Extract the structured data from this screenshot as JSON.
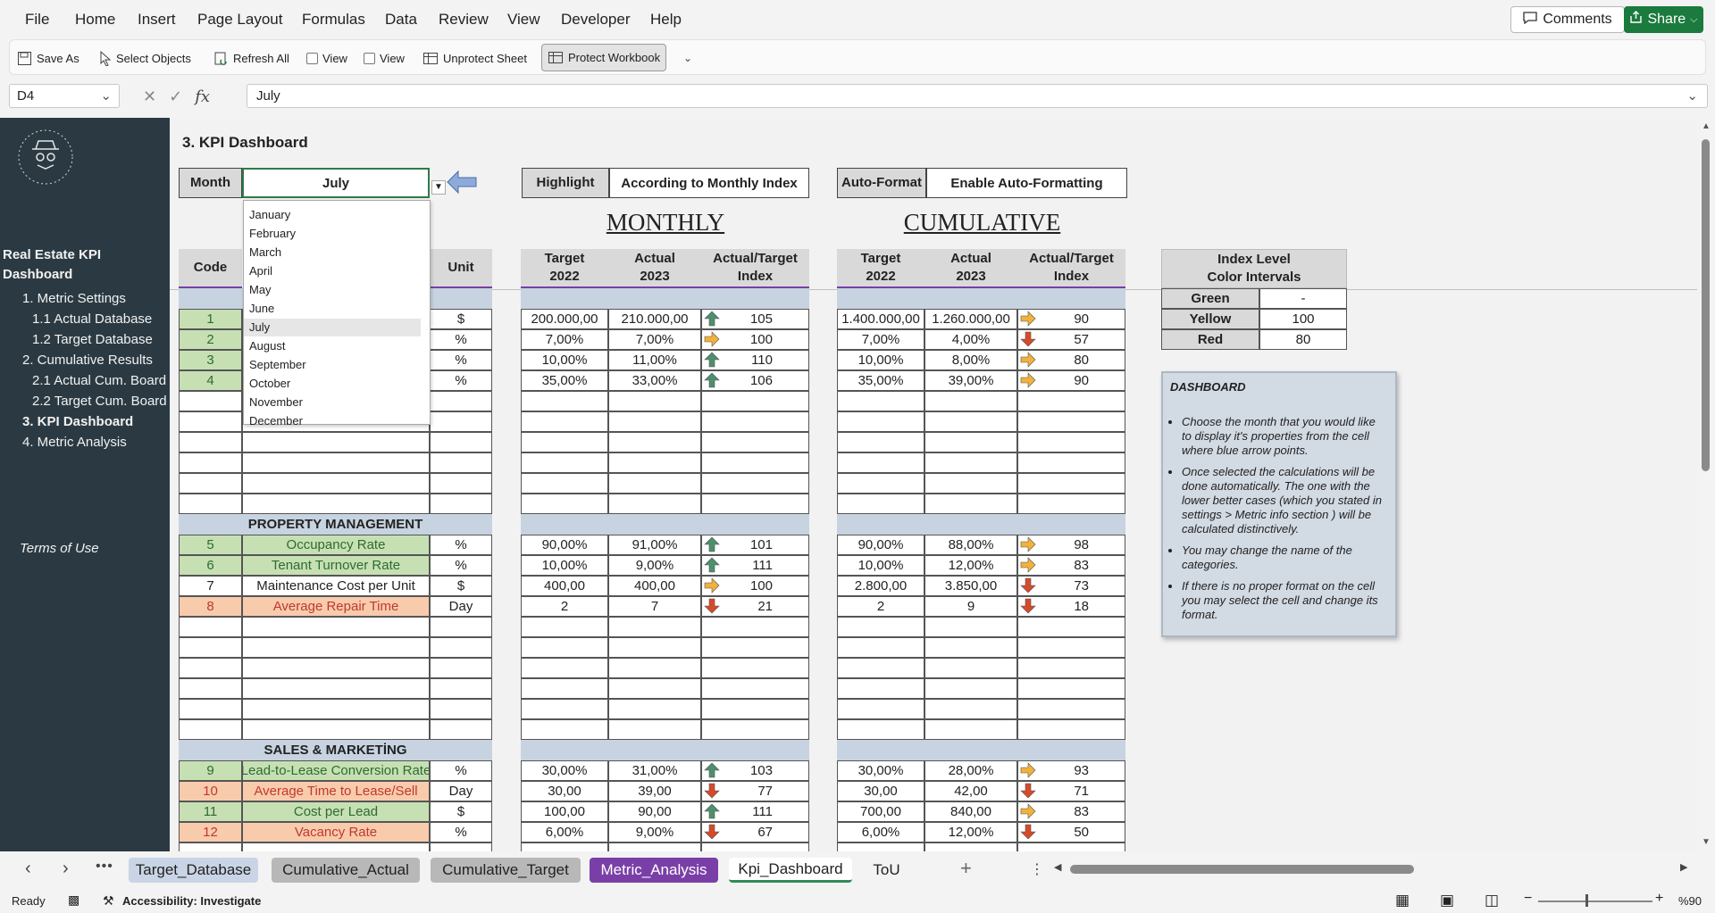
{
  "menu": {
    "file": "File",
    "home": "Home",
    "insert": "Insert",
    "page_layout": "Page Layout",
    "formulas": "Formulas",
    "data": "Data",
    "review": "Review",
    "view": "View",
    "developer": "Developer",
    "help": "Help",
    "comments": "Comments",
    "share": "Share"
  },
  "ribbon": {
    "save_as": "Save As",
    "select_objects": "Select Objects",
    "refresh_all": "Refresh All",
    "view1": "View",
    "view2": "View",
    "unprotect_sheet": "Unprotect Sheet",
    "protect_workbook": "Protect Workbook"
  },
  "formula_bar": {
    "name_box": "D4",
    "value": "July"
  },
  "sidebar": {
    "title_line1": "Real Estate KPI",
    "title_line2": "Dashboard",
    "items": [
      "1. Metric Settings",
      "1.1 Actual Database",
      "1.2 Target Database",
      "2. Cumulative Results",
      "2.1 Actual Cum. Board",
      "2.2 Target Cum. Board",
      "3. KPI Dashboard",
      "4. Metric Analysis"
    ],
    "terms": "Terms of Use"
  },
  "sheet": {
    "title": "3. KPI Dashboard",
    "month_label": "Month",
    "month_value": "July",
    "highlight_label": "Highlight",
    "highlight_value": "According to Monthly Index",
    "autoformat_label": "Auto-Format",
    "autoformat_value": "Enable Auto-Formatting",
    "monthly": "MONTHLY",
    "cumulative": "CUMULATIVE",
    "hdr_code": "Code",
    "hdr_unit": "Unit",
    "hdr_target_1": "Target",
    "hdr_target_2": "2022",
    "hdr_actual_1": "Actual",
    "hdr_actual_2": "2023",
    "hdr_index_1": "Actual/Target",
    "hdr_index_2": "Index",
    "index_title_1": "Index Level",
    "index_title_2": "Color Intervals",
    "index_levels": [
      {
        "name": "Green",
        "value": "-"
      },
      {
        "name": "Yellow",
        "value": "100"
      },
      {
        "name": "Red",
        "value": "80"
      }
    ],
    "section_pm": "PROPERTY MANAGEMENT",
    "section_sm": "SALES & MARKETİNG"
  },
  "month_options": [
    "January",
    "February",
    "March",
    "April",
    "May",
    "June",
    "July",
    "August",
    "September",
    "October",
    "November",
    "December"
  ],
  "rows_top": [
    {
      "code": "1",
      "unit": "$",
      "mt": "200.000,00",
      "ma": "210.000,00",
      "mdir": "up",
      "mi": "105",
      "ct": "1.400.000,00",
      "ca": "1.260.000,00",
      "cdir": "right",
      "ci": "90"
    },
    {
      "code": "2",
      "unit": "%",
      "mt": "7,00%",
      "ma": "7,00%",
      "mdir": "right",
      "mi": "100",
      "ct": "7,00%",
      "ca": "4,00%",
      "cdir": "down",
      "ci": "57"
    },
    {
      "code": "3",
      "unit": "%",
      "mt": "10,00%",
      "ma": "11,00%",
      "mdir": "up",
      "mi": "110",
      "ct": "10,00%",
      "ca": "8,00%",
      "cdir": "right",
      "ci": "80"
    },
    {
      "code": "4",
      "unit": "%",
      "mt": "35,00%",
      "ma": "33,00%",
      "mdir": "up",
      "mi": "106",
      "ct": "35,00%",
      "ca": "39,00%",
      "cdir": "right",
      "ci": "90"
    }
  ],
  "rows_pm": [
    {
      "code": "5",
      "name": "Occupancy Rate",
      "tone": "green",
      "unit": "%",
      "mt": "90,00%",
      "ma": "91,00%",
      "mdir": "up",
      "mi": "101",
      "ct": "90,00%",
      "ca": "88,00%",
      "cdir": "right",
      "ci": "98"
    },
    {
      "code": "6",
      "name": "Tenant Turnover Rate",
      "tone": "green",
      "unit": "%",
      "mt": "10,00%",
      "ma": "9,00%",
      "mdir": "up",
      "mi": "111",
      "ct": "10,00%",
      "ca": "12,00%",
      "cdir": "right",
      "ci": "83"
    },
    {
      "code": "7",
      "name": "Maintenance Cost per Unit",
      "tone": "plain",
      "unit": "$",
      "mt": "400,00",
      "ma": "400,00",
      "mdir": "right",
      "mi": "100",
      "ct": "2.800,00",
      "ca": "3.850,00",
      "cdir": "down",
      "ci": "73"
    },
    {
      "code": "8",
      "name": "Average Repair Time",
      "tone": "red",
      "unit": "Day",
      "mt": "2",
      "ma": "7",
      "mdir": "down",
      "mi": "21",
      "ct": "2",
      "ca": "9",
      "cdir": "down",
      "ci": "18"
    }
  ],
  "rows_sm": [
    {
      "code": "9",
      "name": "Lead-to-Lease Conversion Rate",
      "tone": "green",
      "unit": "%",
      "mt": "30,00%",
      "ma": "31,00%",
      "mdir": "up",
      "mi": "103",
      "ct": "30,00%",
      "ca": "28,00%",
      "cdir": "right",
      "ci": "93"
    },
    {
      "code": "10",
      "name": "Average Time to Lease/Sell",
      "tone": "red",
      "unit": "Day",
      "mt": "30,00",
      "ma": "39,00",
      "mdir": "down",
      "mi": "77",
      "ct": "30,00",
      "ca": "42,00",
      "cdir": "down",
      "ci": "71"
    },
    {
      "code": "11",
      "name": "Cost per Lead",
      "tone": "green",
      "unit": "$",
      "mt": "100,00",
      "ma": "90,00",
      "mdir": "up",
      "mi": "111",
      "ct": "700,00",
      "ca": "840,00",
      "cdir": "right",
      "ci": "83"
    },
    {
      "code": "12",
      "name": "Vacancy Rate",
      "tone": "red",
      "unit": "%",
      "mt": "6,00%",
      "ma": "9,00%",
      "mdir": "down",
      "mi": "67",
      "ct": "6,00%",
      "ca": "12,00%",
      "cdir": "down",
      "ci": "50"
    }
  ],
  "note": {
    "title": "DASHBOARD",
    "bullets": [
      "Choose the month that you would like to display it's properties from the cell where blue arrow points.",
      "Once selected the calculations will be done automatically. The one with the lower better cases (which you stated in settings > Metric info section ) will be calculated distinctively.",
      "You may change the name of the categories.",
      "If there is no proper format on the cell you may select the cell and change its format."
    ]
  },
  "tabs": [
    {
      "label": "Target_Database",
      "style": "blue"
    },
    {
      "label": "Cumulative_Actual",
      "style": "gray"
    },
    {
      "label": "Cumulative_Target",
      "style": "gray"
    },
    {
      "label": "Metric_Analysis",
      "style": "purple"
    },
    {
      "label": "Kpi_Dashboard",
      "style": "active"
    },
    {
      "label": "ToU",
      "style": "plain"
    }
  ],
  "status": {
    "ready": "Ready",
    "accessibility": "Accessibility: Investigate",
    "zoom": "%90"
  },
  "colors": {
    "sidebar": "#2b3a42",
    "green_fill": "#c6e0b4",
    "red_fill": "#f8cbad",
    "band": "#c7d3e0",
    "up": "#4e8f6e",
    "right": "#f2b13a",
    "down": "#d64a2b"
  }
}
